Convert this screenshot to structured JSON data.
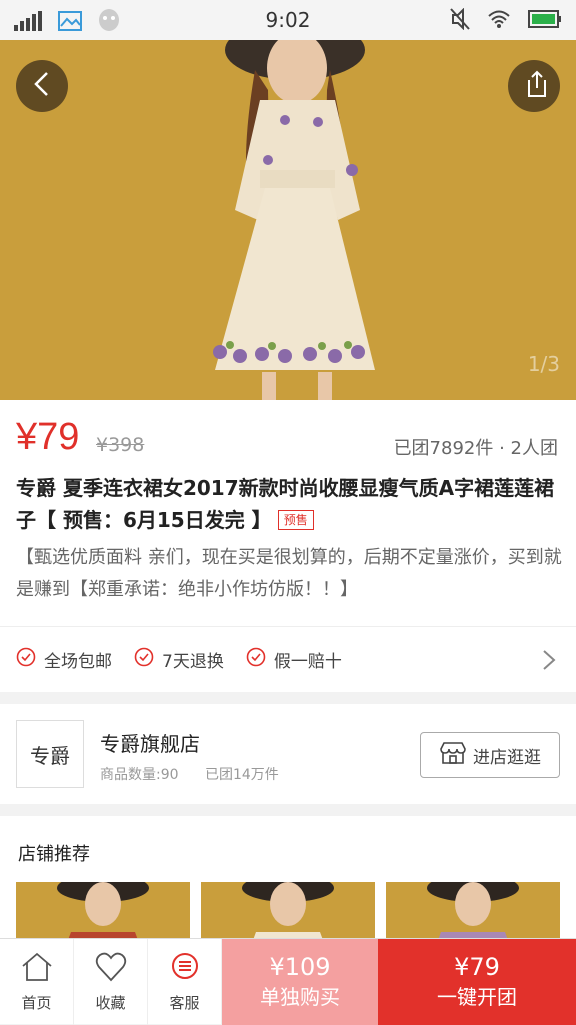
{
  "status_bar": {
    "time": "9:02"
  },
  "hero": {
    "indicator": "1/3"
  },
  "product": {
    "price": "¥79",
    "original_price": "¥398",
    "group_info": "已团7892件 · 2人团",
    "title": "专爵 夏季连衣裙女2017新款时尚收腰显瘦气质A字裙莲莲裙子【 预售：6月15日发完 】",
    "presale_tag": "预售",
    "description": "【甄选优质面料 亲们，现在买是很划算的，后期不定量涨价，买到就是赚到【郑重承诺：绝非小作坊仿版！！】"
  },
  "guarantees": [
    "全场包邮",
    "7天退换",
    "假一赔十"
  ],
  "shop": {
    "logo_text": "专爵",
    "name": "专爵旗舰店",
    "goods_count": "商品数量:90",
    "sold": "已团14万件",
    "visit_label": "进店逛逛"
  },
  "recommend": {
    "title": "店铺推荐"
  },
  "bottom_bar": {
    "home": "首页",
    "favorite": "收藏",
    "service": "客服",
    "solo_price": "¥109",
    "solo_label": "单独购买",
    "group_price": "¥79",
    "group_label": "一键开团"
  },
  "colors": {
    "accent": "#e2312b",
    "accent_light": "#f4a0a0",
    "hero_bg": "#c99e3c"
  }
}
